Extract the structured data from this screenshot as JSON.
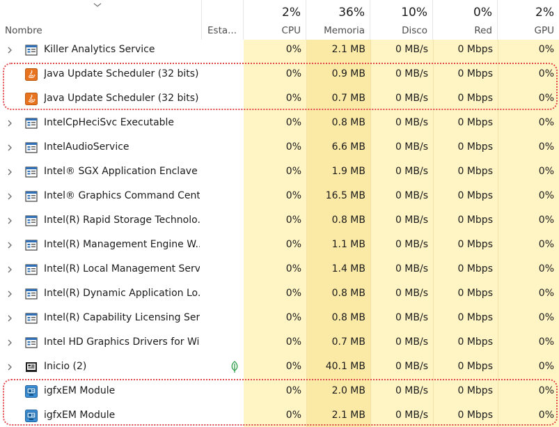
{
  "header": {
    "name_label": "Nombre",
    "state_label": "Esta...",
    "cpu": {
      "percent": "2%",
      "label": "CPU"
    },
    "memory": {
      "percent": "36%",
      "label": "Memoria"
    },
    "disk": {
      "percent": "10%",
      "label": "Disco"
    },
    "network": {
      "percent": "0%",
      "label": "Red"
    },
    "gpu": {
      "percent": "2%",
      "label": "GPU"
    }
  },
  "rows": [
    {
      "name": "Killer Analytics Service",
      "icon": "service-window-icon",
      "cpu": "0%",
      "mem": "2.1 MB",
      "disk": "0 MB/s",
      "net": "0 Mbps",
      "gpu": "0%"
    },
    {
      "name": "Java Update Scheduler (32 bits)",
      "icon": "java-icon",
      "cpu": "0%",
      "mem": "0.9 MB",
      "disk": "0 MB/s",
      "net": "0 Mbps",
      "gpu": "0%"
    },
    {
      "name": "Java Update Scheduler (32 bits)",
      "icon": "java-icon",
      "cpu": "0%",
      "mem": "0.7 MB",
      "disk": "0 MB/s",
      "net": "0 Mbps",
      "gpu": "0%"
    },
    {
      "name": "IntelCpHeciSvc Executable",
      "icon": "service-window-icon",
      "cpu": "0%",
      "mem": "0.8 MB",
      "disk": "0 MB/s",
      "net": "0 Mbps",
      "gpu": "0%"
    },
    {
      "name": "IntelAudioService",
      "icon": "service-window-icon",
      "cpu": "0%",
      "mem": "6.6 MB",
      "disk": "0 MB/s",
      "net": "0 Mbps",
      "gpu": "0%"
    },
    {
      "name": "Intel® SGX Application Enclave ...",
      "icon": "service-window-icon",
      "cpu": "0%",
      "mem": "1.9 MB",
      "disk": "0 MB/s",
      "net": "0 Mbps",
      "gpu": "0%"
    },
    {
      "name": "Intel® Graphics Command Cent...",
      "icon": "service-window-icon",
      "cpu": "0%",
      "mem": "16.5 MB",
      "disk": "0 MB/s",
      "net": "0 Mbps",
      "gpu": "0%"
    },
    {
      "name": "Intel(R) Rapid Storage Technolo...",
      "icon": "service-window-icon",
      "cpu": "0%",
      "mem": "0.8 MB",
      "disk": "0 MB/s",
      "net": "0 Mbps",
      "gpu": "0%"
    },
    {
      "name": "Intel(R) Management Engine W...",
      "icon": "service-window-icon",
      "cpu": "0%",
      "mem": "1.1 MB",
      "disk": "0 MB/s",
      "net": "0 Mbps",
      "gpu": "0%"
    },
    {
      "name": "Intel(R) Local Management Serv...",
      "icon": "service-window-icon",
      "cpu": "0%",
      "mem": "1.4 MB",
      "disk": "0 MB/s",
      "net": "0 Mbps",
      "gpu": "0%"
    },
    {
      "name": "Intel(R) Dynamic Application Lo...",
      "icon": "service-window-icon",
      "cpu": "0%",
      "mem": "0.8 MB",
      "disk": "0 MB/s",
      "net": "0 Mbps",
      "gpu": "0%"
    },
    {
      "name": "Intel(R) Capability Licensing Ser...",
      "icon": "service-window-icon",
      "cpu": "0%",
      "mem": "0.8 MB",
      "disk": "0 MB/s",
      "net": "0 Mbps",
      "gpu": "0%"
    },
    {
      "name": "Intel HD Graphics Drivers for Wi...",
      "icon": "service-window-icon",
      "cpu": "0%",
      "mem": "0.7 MB",
      "disk": "0 MB/s",
      "net": "0 Mbps",
      "gpu": "0%"
    },
    {
      "name": "Inicio (2)",
      "icon": "start-menu-icon",
      "state_icon": "leaf-icon",
      "cpu": "0%",
      "mem": "40.1 MB",
      "disk": "0 MB/s",
      "net": "0 Mbps",
      "gpu": "0%"
    },
    {
      "name": "igfxEM Module",
      "icon": "igfx-module-icon",
      "cpu": "0%",
      "mem": "2.0 MB",
      "disk": "0 MB/s",
      "net": "0 Mbps",
      "gpu": "0%"
    },
    {
      "name": "igfxEM Module",
      "icon": "igfx-module-icon",
      "cpu": "0%",
      "mem": "2.1 MB",
      "disk": "0 MB/s",
      "net": "0 Mbps",
      "gpu": "0%"
    }
  ],
  "colors": {
    "heat_light": "#fff4c4",
    "heat_memory": "#fbe9a6",
    "highlight": "#e0454b",
    "java_orange": "#e8731f",
    "efficiency_green": "#2e9e4b"
  }
}
